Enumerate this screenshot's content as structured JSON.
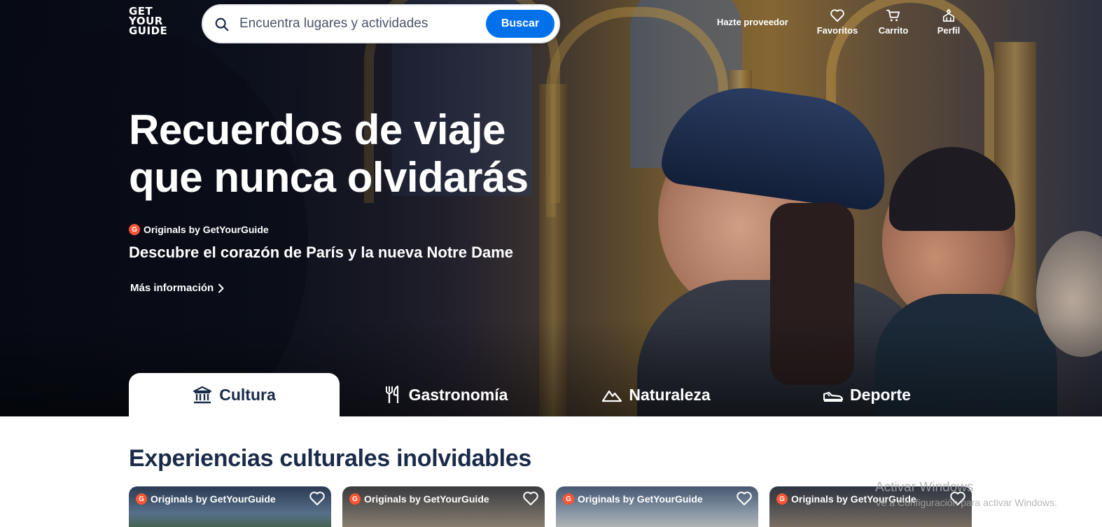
{
  "brand": {
    "logo_lines": [
      "GET",
      "YOUR",
      "GUIDE"
    ]
  },
  "search": {
    "placeholder": "Encuentra lugares y actividades",
    "button_label": "Buscar",
    "icon": "search-icon"
  },
  "nav": {
    "supplier_link": "Hazte proveedor",
    "items": [
      {
        "label": "Favoritos",
        "icon": "heart-icon"
      },
      {
        "label": "Carrito",
        "icon": "cart-icon"
      },
      {
        "label": "Perfil",
        "icon": "profile-icon"
      }
    ]
  },
  "hero": {
    "title_line1": "Recuerdos de viaje",
    "title_line2": "que nunca olvidarás",
    "badge": "Originals by GetYourGuide",
    "badge_icon_letter": "G",
    "subtitle": "Descubre el corazón de París y la nueva Notre Dame",
    "more_link": "Más información"
  },
  "tabs": [
    {
      "label": "Cultura",
      "icon": "museum-icon",
      "active": true
    },
    {
      "label": "Gastronomía",
      "icon": "fork-knife-icon",
      "active": false
    },
    {
      "label": "Naturaleza",
      "icon": "mountain-icon",
      "active": false
    },
    {
      "label": "Deporte",
      "icon": "sneaker-icon",
      "active": false
    }
  ],
  "section": {
    "title": "Experiencias culturales inolvidables"
  },
  "cards": [
    {
      "badge": "Originals by GetYourGuide",
      "icon_letter": "G"
    },
    {
      "badge": "Originals by GetYourGuide",
      "icon_letter": "G"
    },
    {
      "badge": "Originals by GetYourGuide",
      "icon_letter": "G"
    },
    {
      "badge": "Originals by GetYourGuide",
      "icon_letter": "G"
    }
  ],
  "os_watermark": {
    "line1": "Activar Windows",
    "line2": "Ve a Configuración para activar Windows."
  },
  "colors": {
    "primary": "#0071eb",
    "navy": "#1a2b49",
    "originals": "#ff5533"
  }
}
